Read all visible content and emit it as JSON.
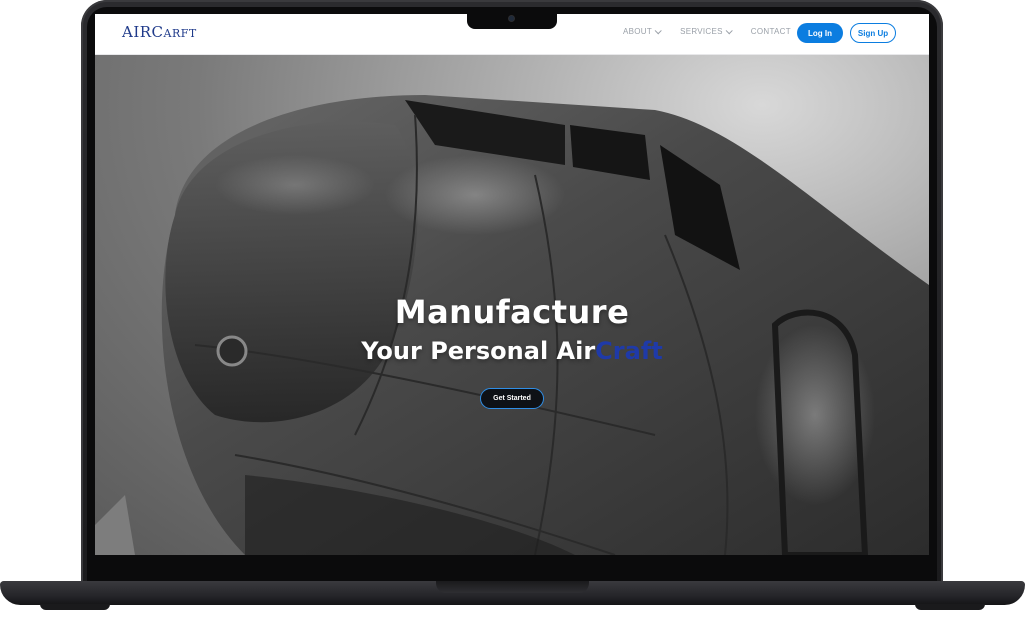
{
  "navbar": {
    "brand_main": "AIRC",
    "brand_rest": "ARFT",
    "links": [
      {
        "label": "ABOUT",
        "has_dropdown": true
      },
      {
        "label": "SERVICES",
        "has_dropdown": true
      },
      {
        "label": "CONTACT",
        "has_dropdown": false
      }
    ],
    "login_label": "Log In",
    "signup_label": "Sign Up"
  },
  "hero": {
    "title": "Manufacture",
    "subtitle_prefix": "Your Personal Air",
    "subtitle_accent": "Craft",
    "cta_label": "Get Started"
  },
  "colors": {
    "brand": "#1f3a8a",
    "primary": "#0b7de0",
    "accent": "#1f3aa8",
    "nav_text": "#9aa0a8"
  }
}
